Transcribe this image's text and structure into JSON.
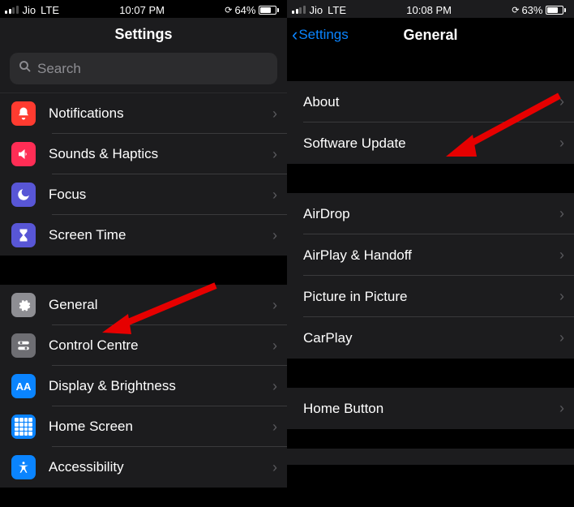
{
  "left": {
    "status": {
      "carrier": "Jio",
      "net": "LTE",
      "time": "10:07 PM",
      "battery_pct": "64%",
      "battery_fill": 64
    },
    "title": "Settings",
    "search_placeholder": "Search",
    "rows": [
      {
        "label": "Notifications"
      },
      {
        "label": "Sounds & Haptics"
      },
      {
        "label": "Focus"
      },
      {
        "label": "Screen Time"
      },
      {
        "label": "General"
      },
      {
        "label": "Control Centre"
      },
      {
        "label": "Display & Brightness"
      },
      {
        "label": "Home Screen"
      },
      {
        "label": "Accessibility"
      }
    ]
  },
  "right": {
    "status": {
      "carrier": "Jio",
      "net": "LTE",
      "time": "10:08 PM",
      "battery_pct": "63%",
      "battery_fill": 63
    },
    "back": "Settings",
    "title": "General",
    "rows": [
      {
        "label": "About"
      },
      {
        "label": "Software Update"
      },
      {
        "label": "AirDrop"
      },
      {
        "label": "AirPlay & Handoff"
      },
      {
        "label": "Picture in Picture"
      },
      {
        "label": "CarPlay"
      },
      {
        "label": "Home Button"
      }
    ]
  }
}
